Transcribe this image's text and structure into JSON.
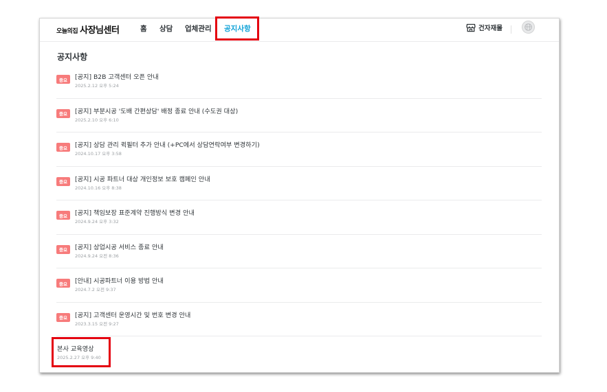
{
  "header": {
    "brand": "오늘의집",
    "title": "사장님센터",
    "nav": [
      {
        "label": "홈",
        "active": false
      },
      {
        "label": "상담",
        "active": false
      },
      {
        "label": "업체관리",
        "active": false
      },
      {
        "label": "공지사항",
        "active": true
      }
    ],
    "store_link": "건자재몰",
    "store_icon": "storefront-icon",
    "avatar_icon": "user-avatar-icon",
    "active_color": "#12a3d8"
  },
  "page": {
    "title": "공지사항"
  },
  "notices": [
    {
      "badge": "중요",
      "title": "[공지] B2B 고객센터 오픈 안내",
      "date": "2025.2.12 오후 5:24"
    },
    {
      "badge": "중요",
      "title": "[공지] 부분시공 '도배 간편상담' 배정 종료 안내 (수도권 대상)",
      "date": "2025.2.10 오후 6:10"
    },
    {
      "badge": "중요",
      "title": "[공지] 상담 관리 퀵필터 추가 안내 (+PC에서 상담연락여부 변경하기)",
      "date": "2024.10.17 오후 3:58"
    },
    {
      "badge": "중요",
      "title": "[공지] 시공 파트너 대상 개인정보 보호 캠페인 안내",
      "date": "2024.10.16 오후 8:38"
    },
    {
      "badge": "중요",
      "title": "[공지] 책임보장 표준계약 진행방식 변경 안내",
      "date": "2024.9.24 오후 3:32"
    },
    {
      "badge": "중요",
      "title": "[공지] 상업시공 서비스 종료 안내",
      "date": "2024.9.24 오전 8:36"
    },
    {
      "badge": "중요",
      "title": "[안내] 시공파트너 이용 방법 안내",
      "date": "2024.7.2 오전 9:37"
    },
    {
      "badge": "중요",
      "title": "[공지] 고객센터 운영시간 및 번호 변경 안내",
      "date": "2023.3.15 오전 9:27"
    },
    {
      "badge": "",
      "title": "본사 교육영상",
      "date": "2025.2.27 오후 9:40"
    }
  ],
  "colors": {
    "badge_bg": "#f77b7b",
    "highlight": "#e4000f"
  }
}
